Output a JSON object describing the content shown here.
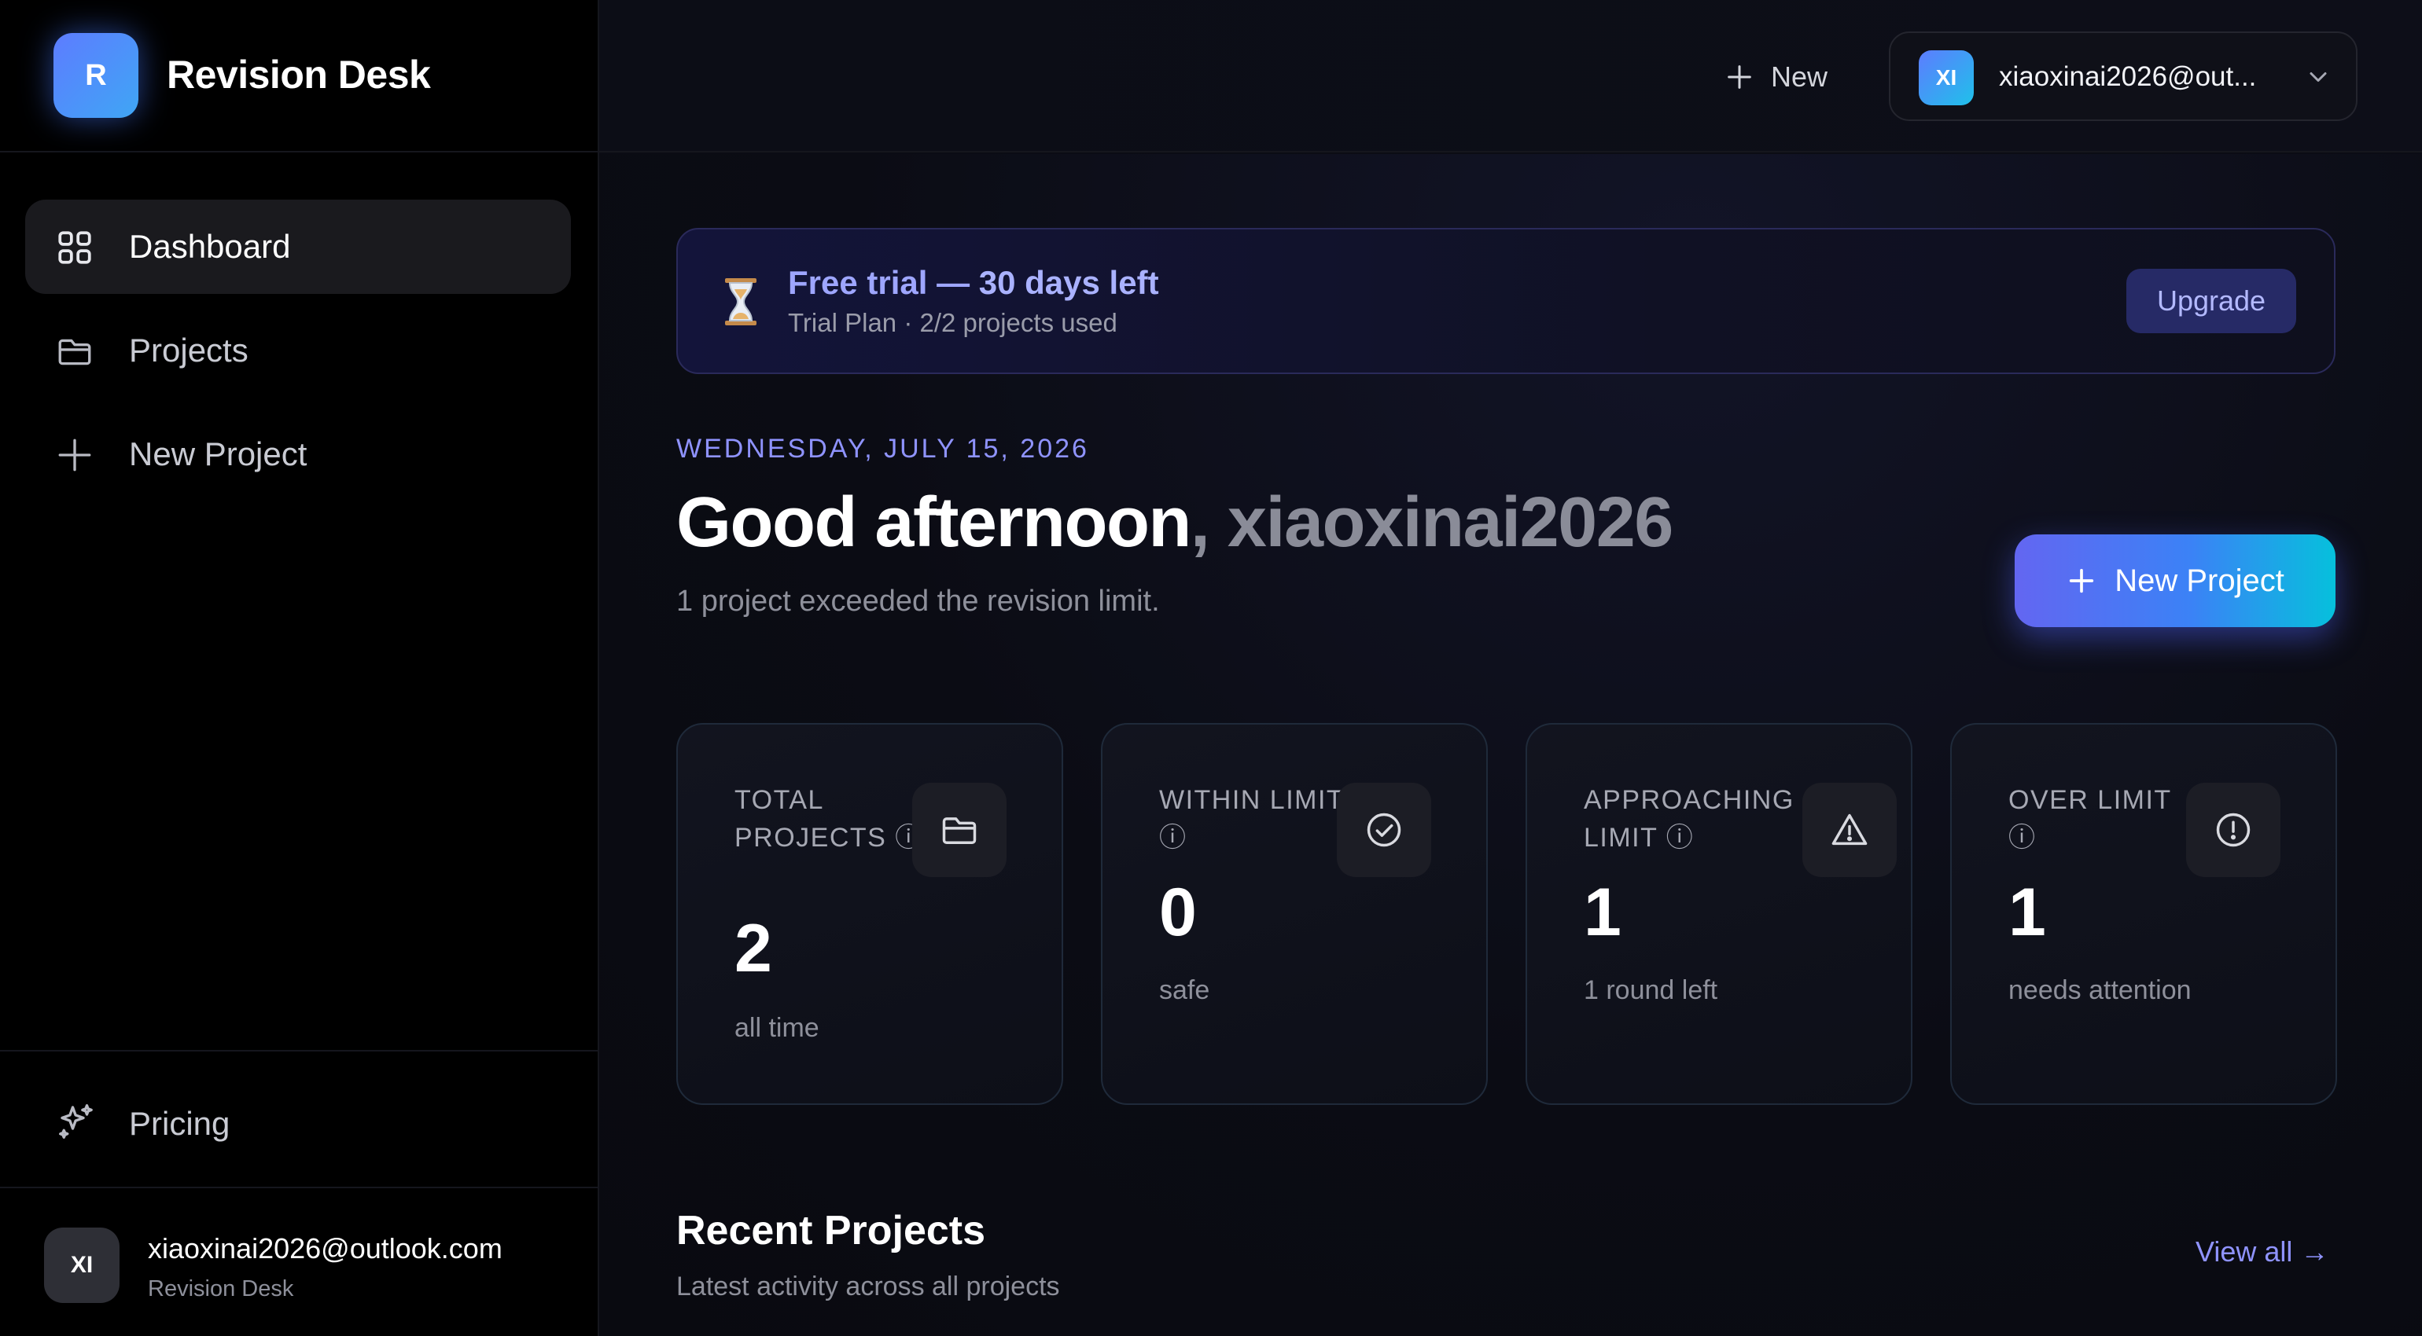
{
  "brand": {
    "logo_letter": "R",
    "name": "Revision Desk"
  },
  "sidebar": {
    "items": [
      {
        "label": "Dashboard",
        "icon": "grid-icon",
        "active": true
      },
      {
        "label": "Projects",
        "icon": "folder-icon",
        "active": false
      },
      {
        "label": "New Project",
        "icon": "plus-icon",
        "active": false
      }
    ],
    "pricing_label": "Pricing",
    "user": {
      "initials": "XI",
      "email": "xiaoxinai2026@outlook.com",
      "org": "Revision Desk"
    }
  },
  "topbar": {
    "new_label": "New",
    "account": {
      "initials": "XI",
      "email": "xiaoxinai2026@out..."
    }
  },
  "trial": {
    "title_prefix": "Free trial — ",
    "title_strong": "30 days left",
    "subtitle": "Trial Plan · 2/2 projects used",
    "upgrade_label": "Upgrade"
  },
  "header": {
    "date": "WEDNESDAY, JULY 15, 2026",
    "greeting": "Good afternoon",
    "name": ", xiaoxinai2026",
    "subtitle": "1 project exceeded the revision limit.",
    "new_project_label": "New Project"
  },
  "stats": [
    {
      "label": "TOTAL PROJECTS ⓘ",
      "value": "2",
      "desc": "all time",
      "icon": "folder-icon"
    },
    {
      "label": "WITHIN LIMIT ⓘ",
      "value": "0",
      "desc": "safe",
      "icon": "check-circle-icon"
    },
    {
      "label": "APPROACHING LIMIT ⓘ",
      "value": "1",
      "desc": "1 round left",
      "icon": "warning-icon"
    },
    {
      "label": "OVER LIMIT ⓘ",
      "value": "1",
      "desc": "needs attention",
      "icon": "alert-circle-icon"
    }
  ],
  "recent": {
    "title": "Recent Projects",
    "subtitle": "Latest activity across all projects",
    "view_all": "View all →"
  },
  "colors": {
    "accent": "#8f93ff",
    "gradient_start": "#6366f1",
    "gradient_end": "#06c0dc"
  }
}
